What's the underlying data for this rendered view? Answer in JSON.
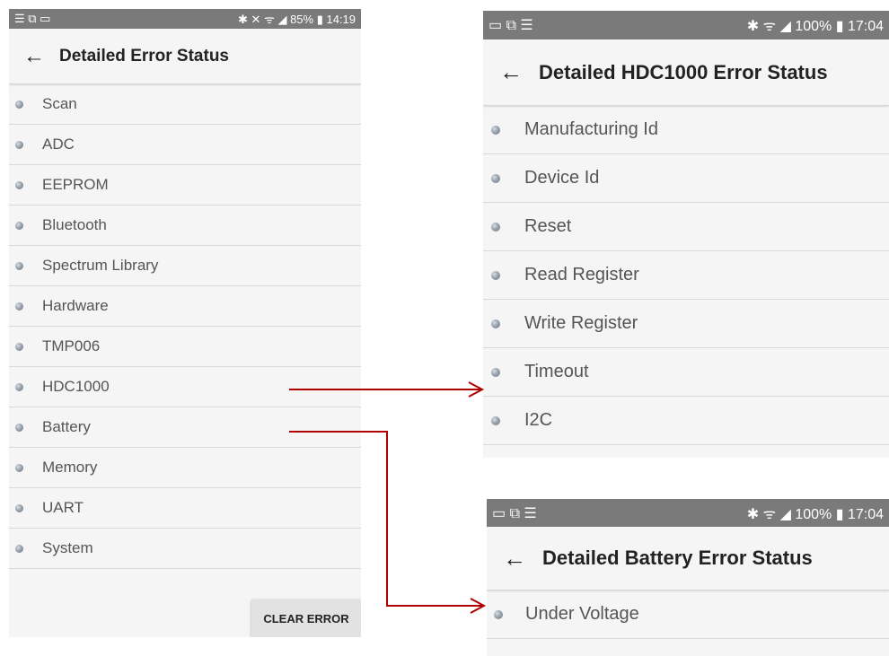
{
  "colors": {
    "arrow": "#b00000",
    "status_bar": "#7a7a7a",
    "background": "#f5f5f5"
  },
  "screens": [
    {
      "status": {
        "left": "☰ ⧉ ▭",
        "right": "✱ ✕ ᯤ ◢ 85% ▮ 14:19"
      },
      "title": "Detailed Error Status",
      "back_icon": "arrow-left-icon",
      "items": [
        "Scan",
        "ADC",
        "EEPROM",
        "Bluetooth",
        "Spectrum Library",
        "Hardware",
        "TMP006",
        "HDC1000",
        "Battery",
        "Memory",
        "UART",
        "System"
      ],
      "clear_button": "CLEAR ERROR"
    },
    {
      "status": {
        "left": "▭ ⧉ ☰",
        "right": "✱ ᯤ ◢ 100% ▮ 17:04"
      },
      "title": "Detailed HDC1000 Error Status",
      "back_icon": "arrow-left-icon",
      "items": [
        "Manufacturing Id",
        "Device Id",
        "Reset",
        "Read Register",
        "Write Register",
        "Timeout",
        "I2C"
      ]
    },
    {
      "status": {
        "left": "▭ ⧉ ☰",
        "right": "✱ ᯤ ◢ 100% ▮ 17:04"
      },
      "title": "Detailed Battery Error Status",
      "back_icon": "arrow-left-icon",
      "items": [
        "Under Voltage"
      ]
    }
  ]
}
